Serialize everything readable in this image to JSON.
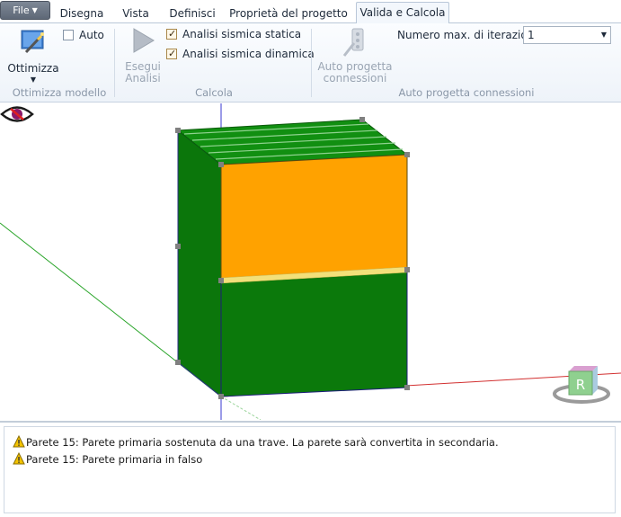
{
  "tabs": {
    "file": "File",
    "items": [
      "Disegna",
      "Vista",
      "Definisci",
      "Proprietà del progetto",
      "Valida e Calcola"
    ],
    "active": "Valida e Calcola"
  },
  "ribbon": {
    "optimize": {
      "button_label": "Ottimizza",
      "auto_label": "Auto",
      "auto_checked": false,
      "group_label": "Ottimizza modello",
      "icon": "magic-wand-icon"
    },
    "calc": {
      "run_label_line1": "Esegui",
      "run_label_line2": "Analisi",
      "run_icon": "play-icon",
      "static_label": "Analisi sismica statica",
      "static_checked": true,
      "dynamic_label": "Analisi sismica dinamica",
      "dynamic_checked": true,
      "group_label": "Calcola"
    },
    "connections": {
      "button_line1": "Auto progetta",
      "button_line2": "connessioni",
      "icon": "connection-wand-icon",
      "iterations_label": "Numero max. di iterazioni",
      "iterations_value": "1",
      "group_label": "Auto progetta connessioni"
    }
  },
  "view": {
    "eye_icon": "hidden-eye-icon",
    "cube_label": "R",
    "colors": {
      "wall": "#0a7a0a",
      "highlight": "#ffa200",
      "beam": "#f2e07a"
    }
  },
  "messages": [
    {
      "icon": "warning-icon",
      "text": "Parete 15: Parete primaria sostenuta da una trave. La parete sarà convertita in secondaria."
    },
    {
      "icon": "warning-icon",
      "text": "Parete 15: Parete primaria in falso"
    }
  ]
}
